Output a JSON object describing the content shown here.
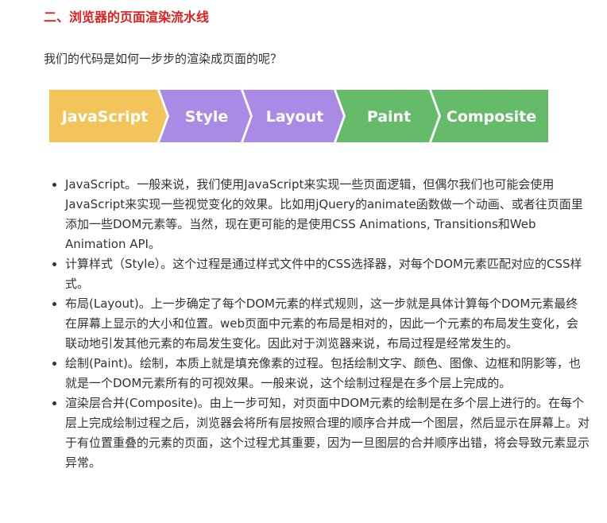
{
  "heading": "二、浏览器的页面渲染流水线",
  "intro": "我们的代码是如何一步步的渲染成页面的呢？",
  "pipeline": {
    "steps": [
      {
        "label": "JavaScript",
        "color": "#f2c45a"
      },
      {
        "label": "Style",
        "color": "#a98be6"
      },
      {
        "label": "Layout",
        "color": "#a98be6"
      },
      {
        "label": "Paint",
        "color": "#66bb6a"
      },
      {
        "label": "Composite",
        "color": "#66bb6a"
      }
    ]
  },
  "items": [
    "JavaScript。一般来说，我们使用JavaScript来实现一些页面逻辑，但偶尔我们也可能会使用JavaScript来实现一些视觉变化的效果。比如用jQuery的animate函数做一个动画、或者往页面里添加一些DOM元素等。当然，现在更可能的是使用CSS Animations, Transitions和Web Animation API。",
    "计算样式（Style）。这个过程是通过样式文件中的CSS选择器，对每个DOM元素匹配对应的CSS样式。",
    "布局(Layout)。上一步确定了每个DOM元素的样式规则，这一步就是具体计算每个DOM元素最终在屏幕上显示的大小和位置。web页面中元素的布局是相对的，因此一个元素的布局发生变化，会联动地引发其他元素的布局发生变化。因此对于浏览器来说，布局过程是经常发生的。",
    "绘制(Paint)。绘制，本质上就是填充像素的过程。包括绘制文字、颜色、图像、边框和阴影等，也就是一个DOM元素所有的可视效果。一般来说，这个绘制过程是在多个层上完成的。",
    "渲染层合并(Composite)。由上一步可知，对页面中DOM元素的绘制是在多个层上进行的。在每个层上完成绘制过程之后，浏览器会将所有层按照合理的顺序合并成一个图层，然后显示在屏幕上。对于有位置重叠的元素的页面，这个过程尤其重要，因为一旦图层的合并顺序出错，将会导致元素显示异常。"
  ]
}
